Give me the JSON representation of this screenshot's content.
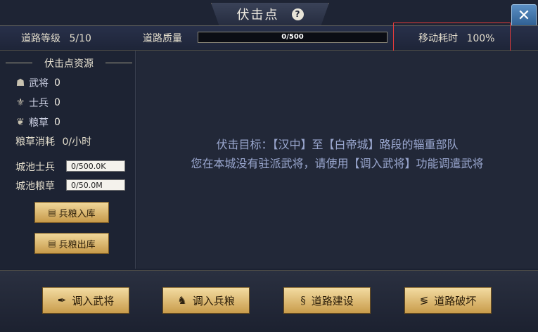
{
  "header": {
    "title": "伏击点",
    "help_glyph": "?",
    "close_glyph": "✕"
  },
  "stats": {
    "road_level_label": "道路等级",
    "road_level_value": "5/10",
    "road_quality_label": "道路质量",
    "road_quality_text": "0/500",
    "road_quality_fraction": 0,
    "move_cost_label": "移动耗时",
    "move_cost_value": "100%"
  },
  "resources": {
    "section_title": "伏击点资源",
    "general_label": "武将",
    "general_value": "0",
    "soldier_label": "士兵",
    "soldier_value": "0",
    "grain_label": "粮草",
    "grain_value": "0",
    "consumption_label": "粮草消耗",
    "consumption_value": "0/小时",
    "city_soldiers_label": "城池士兵",
    "city_soldiers_value": "0/500.0K",
    "city_grain_label": "城池粮草",
    "city_grain_value": "0/50.0M",
    "store_button": "兵粮入库",
    "withdraw_button": "兵粮出库"
  },
  "main": {
    "line1": "伏击目标：【汉中】至【白帝城】路段的辎重部队",
    "line2": "您在本城没有驻派武将，请使用【调入武将】功能调遣武将"
  },
  "actions": {
    "transfer_general": "调入武将",
    "transfer_supplies": "调入兵粮",
    "build_road": "道路建设",
    "destroy_road": "道路破坏"
  }
}
